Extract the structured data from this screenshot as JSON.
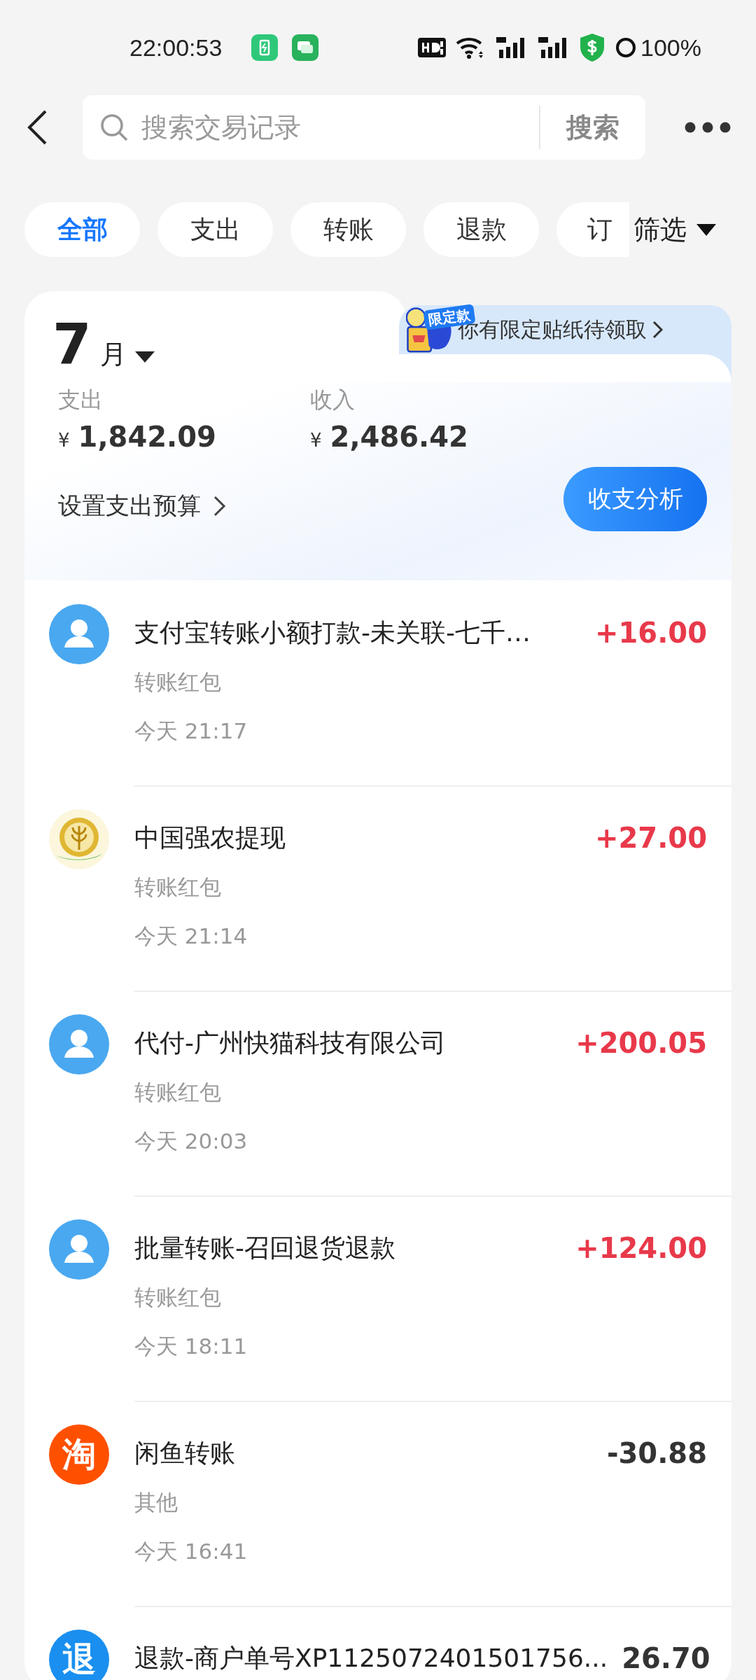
{
  "status_bar": {
    "time": "22:00:53",
    "battery": "100%"
  },
  "search": {
    "placeholder": "搜索交易记录",
    "button": "搜索"
  },
  "tabs": [
    {
      "label": "全部",
      "selected": true
    },
    {
      "label": "支出",
      "selected": false
    },
    {
      "label": "转账",
      "selected": false
    },
    {
      "label": "退款",
      "selected": false
    },
    {
      "label": "订",
      "selected": false
    }
  ],
  "filter": {
    "label": "筛选"
  },
  "summary": {
    "month": "7",
    "month_unit": "月",
    "banner": {
      "badge": "限定款",
      "text": "你有限定贴纸待领取"
    },
    "expense": {
      "label": "支出",
      "currency": "¥",
      "amount": "1,842.09"
    },
    "income": {
      "label": "收入",
      "currency": "¥",
      "amount": "2,486.42"
    },
    "budget_link": "设置支出预算",
    "analysis_button": "收支分析"
  },
  "transactions": [
    {
      "avatar": {
        "kind": "person"
      },
      "title": "支付宝转账小额打款-未关联-七千…",
      "amount": "+16.00",
      "income": true,
      "category": "转账红包",
      "time": "今天 21:17"
    },
    {
      "avatar": {
        "kind": "wheat"
      },
      "title": "中国强农提现",
      "amount": "+27.00",
      "income": true,
      "category": "转账红包",
      "time": "今天 21:14"
    },
    {
      "avatar": {
        "kind": "person"
      },
      "title": "代付-广州快猫科技有限公司",
      "amount": "+200.05",
      "income": true,
      "category": "转账红包",
      "time": "今天 20:03"
    },
    {
      "avatar": {
        "kind": "person"
      },
      "title": "批量转账-召回退货退款",
      "amount": "+124.00",
      "income": true,
      "category": "转账红包",
      "time": "今天 18:11"
    },
    {
      "avatar": {
        "kind": "text",
        "text": "淘",
        "color": "#ff5000"
      },
      "title": "闲鱼转账",
      "amount": "-30.88",
      "income": false,
      "category": "其他",
      "time": "今天 16:41"
    },
    {
      "avatar": {
        "kind": "text",
        "text": "退",
        "color": "#1a8fef"
      },
      "title": "退款-商户单号XP1125072401501756...",
      "amount": "26.70",
      "income": false
    }
  ]
}
